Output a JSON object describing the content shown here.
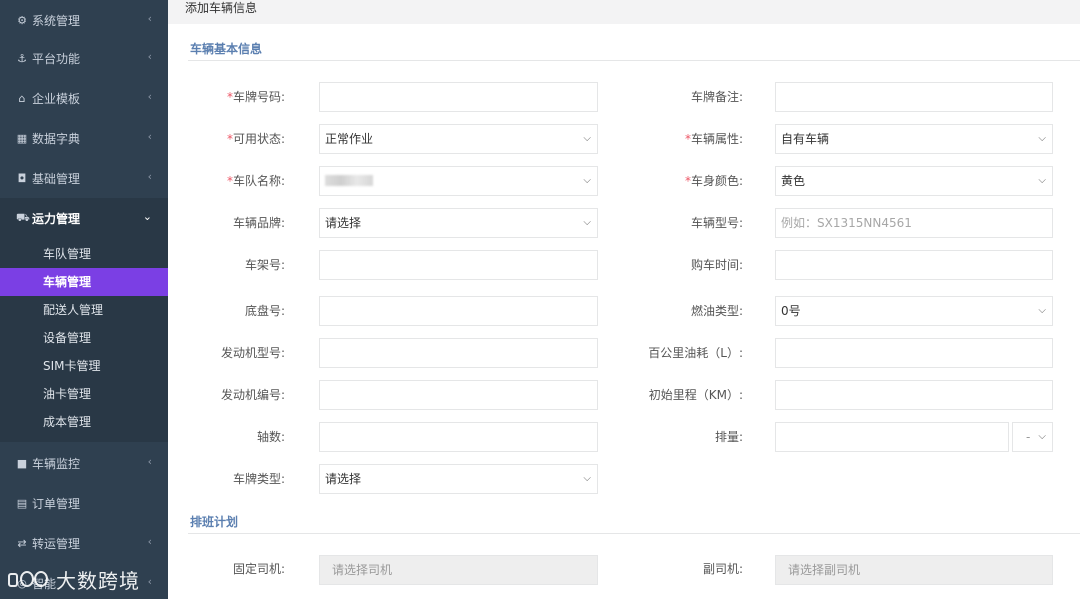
{
  "sidebar": {
    "items": [
      {
        "icon": "gear-icon",
        "glyph": "⚙",
        "label": "系统管理"
      },
      {
        "icon": "anchor-icon",
        "glyph": "⚓",
        "label": "平台功能"
      },
      {
        "icon": "bank-icon",
        "glyph": "🏛",
        "label": "企业模板"
      },
      {
        "icon": "table-icon",
        "glyph": "▦",
        "label": "数据字典"
      },
      {
        "icon": "data-icon",
        "glyph": "◘",
        "label": "基础管理"
      },
      {
        "icon": "truck-icon",
        "glyph": "⛟",
        "label": "运力管理"
      },
      {
        "icon": "video-icon",
        "glyph": "▶",
        "label": "车辆监控"
      },
      {
        "icon": "list-icon",
        "glyph": "▤",
        "label": "订单管理"
      },
      {
        "icon": "exchange-icon",
        "glyph": "⇄",
        "label": "转运管理"
      },
      {
        "icon": "smart-icon",
        "glyph": "◎",
        "label": "智能"
      }
    ],
    "submenu": [
      "车队管理",
      "车辆管理",
      "配送人管理",
      "设备管理",
      "SIM卡管理",
      "油卡管理",
      "成本管理"
    ]
  },
  "watermark": "大数跨境",
  "page": {
    "title": "添加车辆信息"
  },
  "sections": {
    "basic": "车辆基本信息",
    "schedule": "排班计划"
  },
  "form": {
    "plate_no": "车牌号码:",
    "plate_note": "车牌备注:",
    "status": "可用状态:",
    "status_value": "正常作业",
    "attribute": "车辆属性:",
    "attribute_value": "自有车辆",
    "fleet": "车队名称:",
    "body_color": "车身颜色:",
    "body_color_value": "黄色",
    "brand": "车辆品牌:",
    "brand_value": "请选择",
    "model": "车辆型号:",
    "model_placeholder": "例如：SX1315NN4561",
    "frame_no": "车架号:",
    "purchase_time": "购车时间:",
    "chassis_no": "底盘号:",
    "fuel_type": "燃油类型:",
    "fuel_type_value": "0号",
    "engine_model": "发动机型号:",
    "fuel_consumption": "百公里油耗（L）:",
    "engine_no": "发动机编号:",
    "initial_mileage": "初始里程（KM）:",
    "axles": "轴数:",
    "displacement": "排量:",
    "displacement_unit": "-",
    "plate_type": "车牌类型:",
    "plate_type_value": "请选择",
    "main_driver": "固定司机:",
    "main_driver_placeholder": "请选择司机",
    "co_driver": "副司机:",
    "co_driver_placeholder": "请选择副司机"
  },
  "colors": {
    "sidebar_bg": "#2f4050",
    "active_item": "#7b3fe4",
    "section_title": "#5b7fb0",
    "required": "#ed5565"
  }
}
